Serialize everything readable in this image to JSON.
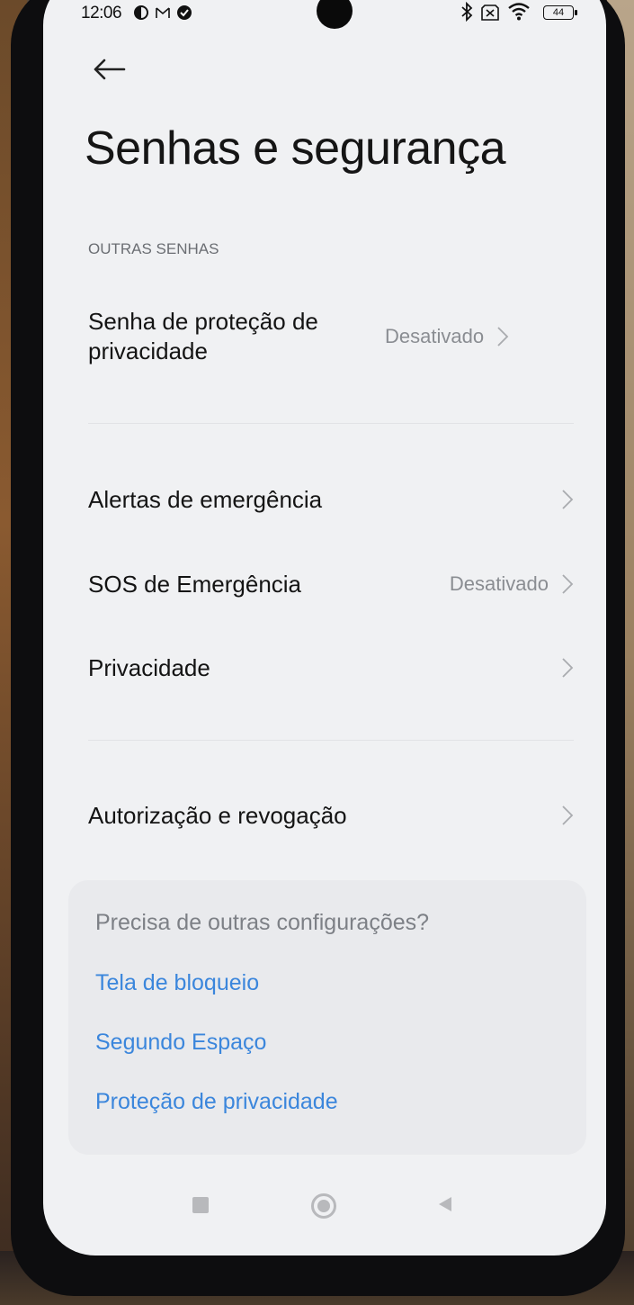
{
  "status_bar": {
    "time": "12:06",
    "battery": "44",
    "left_icons": [
      "data-saver-icon",
      "gmail-icon",
      "check-circle-icon"
    ],
    "right_icons": [
      "bluetooth-icon",
      "no-sim-icon",
      "wifi-icon",
      "battery-icon"
    ]
  },
  "page": {
    "title": "Senhas e segurança",
    "section_header": "OUTRAS SENHAS"
  },
  "settings": {
    "privacy_password": {
      "label": "Senha de proteção de privacidade",
      "value": "Desativado"
    },
    "emergency_alerts": {
      "label": "Alertas de emergência"
    },
    "emergency_sos": {
      "label": "SOS de Emergência",
      "value": "Desativado"
    },
    "privacy": {
      "label": "Privacidade"
    },
    "authorization": {
      "label": "Autorização e revogação"
    }
  },
  "suggestions": {
    "question": "Precisa de outras configurações?",
    "links": [
      "Tela de bloqueio",
      "Segundo Espaço",
      "Proteção de privacidade"
    ]
  },
  "colors": {
    "link": "#3b86dc",
    "background": "#f0f1f3"
  }
}
